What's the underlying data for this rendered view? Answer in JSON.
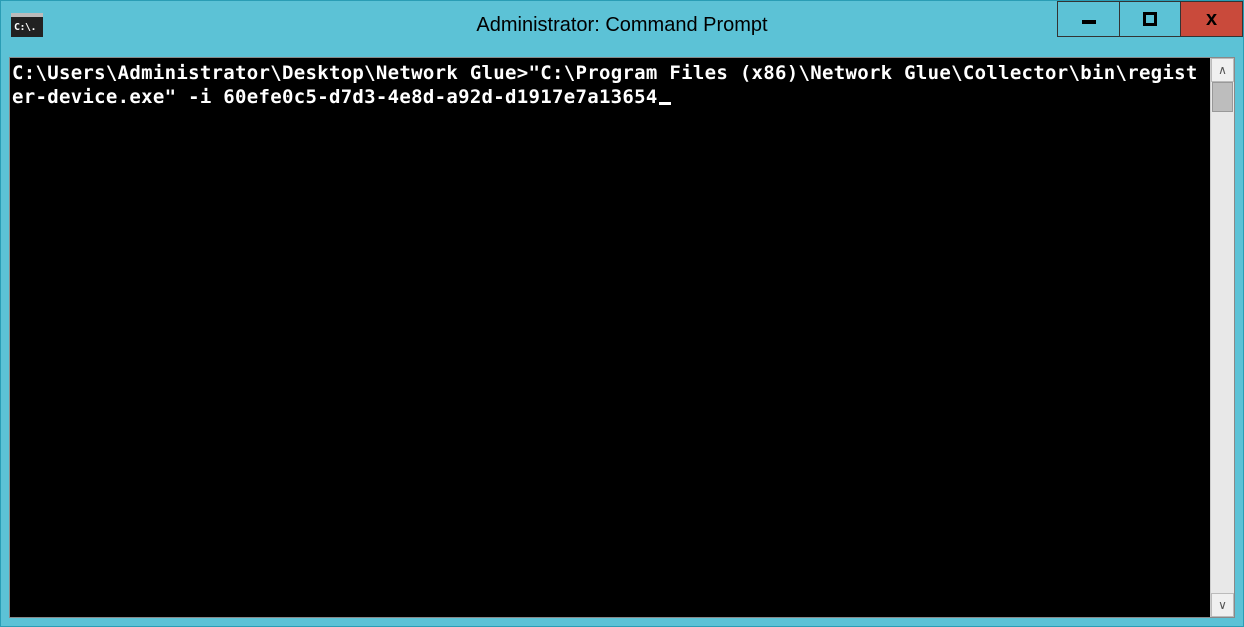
{
  "window": {
    "title": "Administrator: Command Prompt",
    "icon_label": "C:\\."
  },
  "controls": {
    "minimize": "minimize",
    "maximize": "maximize",
    "close": "close",
    "close_glyph": "x"
  },
  "terminal": {
    "prompt": "C:\\Users\\Administrator\\Desktop\\Network Glue>",
    "command": "\"C:\\Program Files (x86)\\Network Glue\\Collector\\bin\\register-device.exe\" -i 60efe0c5-d7d3-4e8d-a92d-d1917e7a13654"
  },
  "scrollbar": {
    "up_glyph": "∧",
    "down_glyph": "∨"
  }
}
